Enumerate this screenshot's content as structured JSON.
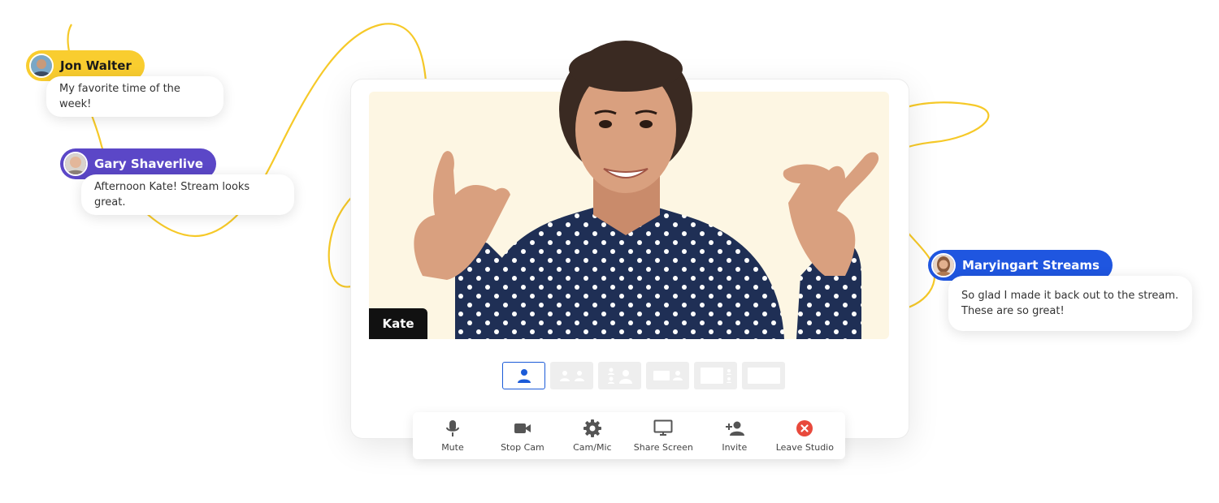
{
  "colors": {
    "yellow": "#f9cd2f",
    "purple": "#5b47c7",
    "blue": "#1f56e0",
    "leave_red": "#e8493c",
    "active_blue": "#1b5bd8"
  },
  "presenter": {
    "name": "Kate"
  },
  "layout_options": [
    {
      "icon": "single-person-icon",
      "active": true
    },
    {
      "icon": "two-people-icon",
      "active": false
    },
    {
      "icon": "three-people-icon",
      "active": false
    },
    {
      "icon": "screen-and-person-icon",
      "active": false
    },
    {
      "icon": "screen-and-small-people-icon",
      "active": false
    },
    {
      "icon": "full-screen-icon",
      "active": false
    }
  ],
  "toolbar": {
    "mute": {
      "label": "Mute",
      "icon": "microphone-icon"
    },
    "stop_cam": {
      "label": "Stop Cam",
      "icon": "camera-icon"
    },
    "cam_mic": {
      "label": "Cam/Mic",
      "icon": "gear-icon"
    },
    "share_screen": {
      "label": "Share Screen",
      "icon": "monitor-icon"
    },
    "invite": {
      "label": "Invite",
      "icon": "add-person-icon"
    },
    "leave": {
      "label": "Leave Studio",
      "icon": "close-circle-icon"
    }
  },
  "chat": [
    {
      "user": "Jon Walter",
      "message": "My favorite time of the week!"
    },
    {
      "user": "Gary Shaverlive",
      "message": "Afternoon Kate! Stream looks great."
    },
    {
      "user": "Maryingart Streams",
      "message": "So glad I made it back out to the stream. These are so great!"
    }
  ]
}
